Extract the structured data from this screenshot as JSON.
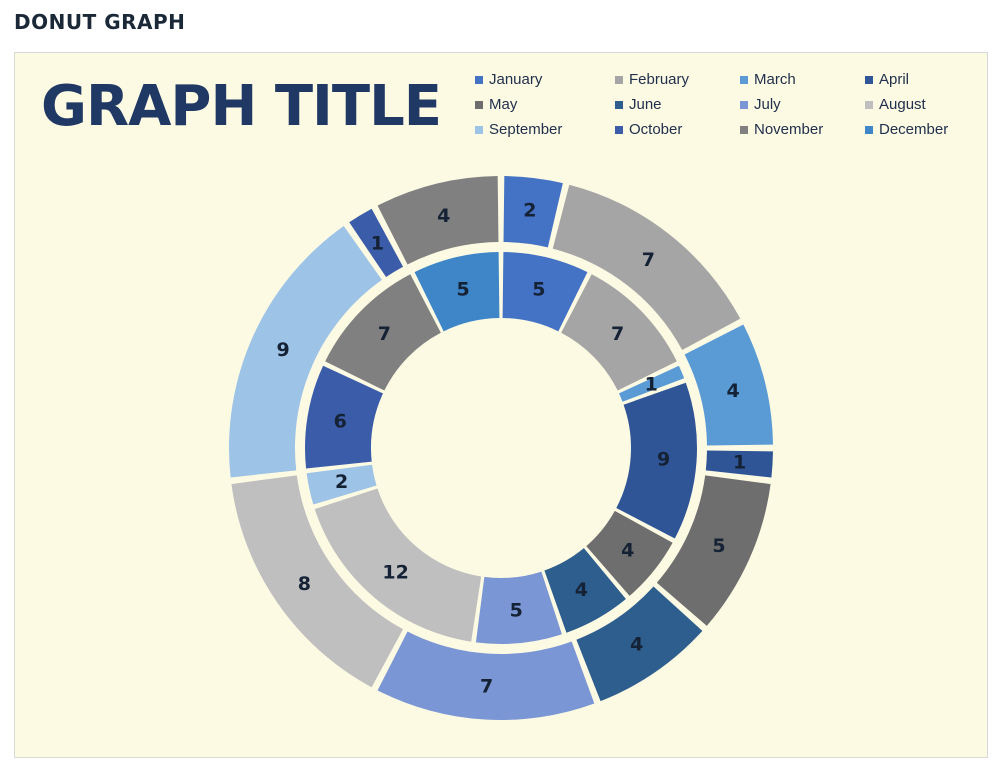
{
  "page": {
    "heading": "DONUT GRAPH"
  },
  "chart_card": {
    "background_color": "#FDFAE4",
    "border_color": "#D9D9D9",
    "title": "GRAPH TITLE",
    "title_color": "#203864"
  },
  "legend": {
    "position": "top-right",
    "items": [
      {
        "label": "January",
        "color": "#4472C4"
      },
      {
        "label": "February",
        "color": "#A5A5A5"
      },
      {
        "label": "March",
        "color": "#5B9BD5"
      },
      {
        "label": "April",
        "color": "#2F5597"
      },
      {
        "label": "May",
        "color": "#6E6E6E"
      },
      {
        "label": "June",
        "color": "#2E5E8E"
      },
      {
        "label": "July",
        "color": "#7B96D4"
      },
      {
        "label": "August",
        "color": "#BFBFBF"
      },
      {
        "label": "September",
        "color": "#9DC3E6"
      },
      {
        "label": "October",
        "color": "#3B5CA8"
      },
      {
        "label": "November",
        "color": "#808080"
      },
      {
        "label": "December",
        "color": "#3E86C8"
      }
    ]
  },
  "chart_data": {
    "type": "pie",
    "variant": "donut-nested",
    "title": "GRAPH TITLE",
    "categories": [
      "January",
      "February",
      "March",
      "April",
      "May",
      "June",
      "July",
      "August",
      "September",
      "October",
      "November",
      "December"
    ],
    "colors": [
      "#4472C4",
      "#A5A5A5",
      "#5B9BD5",
      "#2F5597",
      "#6E6E6E",
      "#2E5E8E",
      "#7B96D4",
      "#BFBFBF",
      "#9DC3E6",
      "#3B5CA8",
      "#808080",
      "#3E86C8"
    ],
    "start_angle_deg": -90,
    "direction": "clockwise",
    "show_labels": true,
    "label_color": "#152235",
    "slice_gap_deg": 1.4,
    "series": [
      {
        "name": "Inner ring",
        "ring": "inner",
        "inner_radius": 130,
        "outer_radius": 196,
        "values": [
          5,
          7,
          1,
          9,
          4,
          4,
          5,
          12,
          2,
          6,
          7,
          5
        ],
        "total": 67
      },
      {
        "name": "Outer ring",
        "ring": "outer",
        "inner_radius": 206,
        "outer_radius": 272,
        "values": [
          2,
          7,
          4,
          1,
          5,
          4,
          7,
          8,
          9,
          1,
          4
        ],
        "total": 52
      }
    ],
    "legend_position": "top-right",
    "grid": false,
    "xlabel": "",
    "ylabel": ""
  }
}
